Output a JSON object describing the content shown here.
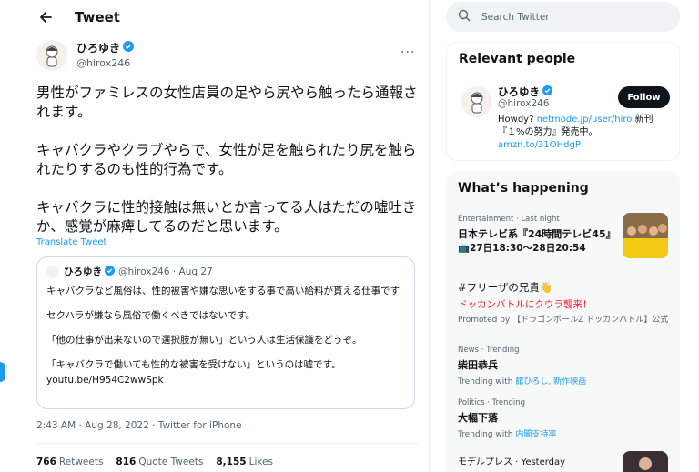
{
  "header": {
    "title": "Tweet"
  },
  "tweet": {
    "name": "ひろゆき",
    "handle": "@hirox246",
    "paragraphs": [
      "男性がファミレスの女性店員の足やら尻やら触ったら通報されます。",
      "キャバクラやクラブやらで、女性が足を触られたり尻を触られたりするのも性的行為です。",
      "キャバクラに性的接触は無いとか言ってる人はただの嘘吐きか、感覚が麻痺してるのだと思います。"
    ],
    "translate": "Translate Tweet",
    "timestamp": "2:43 AM · Aug 28, 2022 · Twitter for iPhone",
    "stats": {
      "retweets_count": "766",
      "retweets_label": "Retweets",
      "quotes_count": "816",
      "quotes_label": "Quote Tweets",
      "likes_count": "8,155",
      "likes_label": "Likes"
    }
  },
  "quote": {
    "name": "ひろゆき",
    "meta": "@hirox246 · Aug 27",
    "lines": [
      "キャバクラなど風俗は、性的被害や嫌な思いをする事で高い給料が貰える仕事です",
      "セクハラが嫌なら風俗で働くべきではないです。",
      "「他の仕事が出来ないので選択肢が無い」という人は生活保護をどうぞ。",
      "「キャバクラで働いても性的な被害を受けない」というのは嘘です。"
    ],
    "url": "youtu.be/H954C2wwSpk"
  },
  "search": {
    "placeholder": "Search Twitter"
  },
  "relevant": {
    "title": "Relevant people",
    "name": "ひろゆき",
    "handle": "@hirox246",
    "follow": "Follow",
    "bio_prefix": "Howdy? ",
    "bio_link1": "netmode.jp/user/hiro",
    "bio_mid": " 新刊『１%の努力』発売中。",
    "bio_link2": "amzn.to/31OHdgP"
  },
  "happening": {
    "title": "What’s happening",
    "trends": [
      {
        "meta": "Entertainment · Last night",
        "title": "日本テレビ系『24時間テレビ45』",
        "sub": "📺27日18:30〜28日20:54"
      },
      {
        "title": "#フリーザの兄貴👋",
        "sub": "ドッカンバトルにクウラ襲来！",
        "promo": "Promoted by 【ドラゴンボールZ ドッカンバトル】公式"
      },
      {
        "meta": "News · Trending",
        "title": "柴田恭兵",
        "link_prefix": "Trending with ",
        "link": "舘ひろし, 新作映画"
      },
      {
        "meta": "Politics · Trending",
        "title": "大幅下落",
        "link_prefix": "Trending with ",
        "link": "内閣支持率"
      },
      {
        "meta": "モデルプレス · Yesterday"
      }
    ]
  },
  "colors": {
    "accent": "#1d9bf0",
    "text": "#0f1419",
    "muted": "#536471"
  }
}
